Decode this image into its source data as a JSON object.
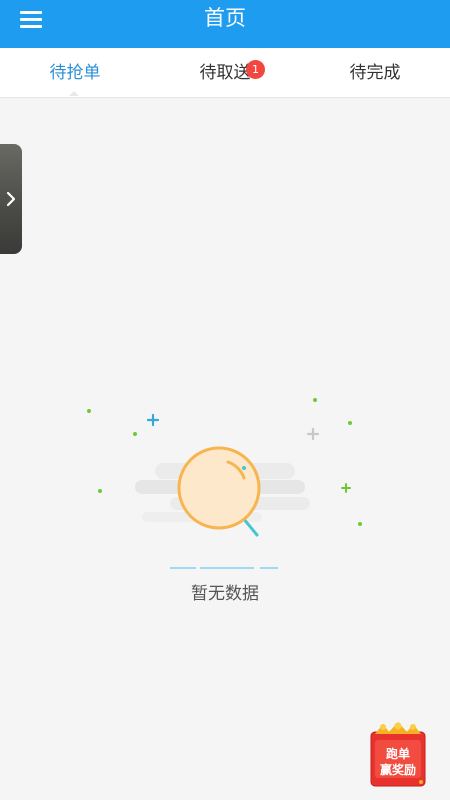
{
  "header": {
    "title": "首页",
    "background": "#1e9cf0"
  },
  "tabs": [
    {
      "label": "待抢单",
      "active": true
    },
    {
      "label": "待取送",
      "badge": "1"
    },
    {
      "label": "待完成"
    }
  ],
  "empty_state": {
    "text": "暂无数据"
  },
  "reward": {
    "line1": "跑单",
    "line2": "赢奖励"
  },
  "colors": {
    "accent": "#1e9cf0",
    "active_tab": "#2c8fd6",
    "badge": "#f2473e",
    "magnifier": "#f6b54e"
  }
}
